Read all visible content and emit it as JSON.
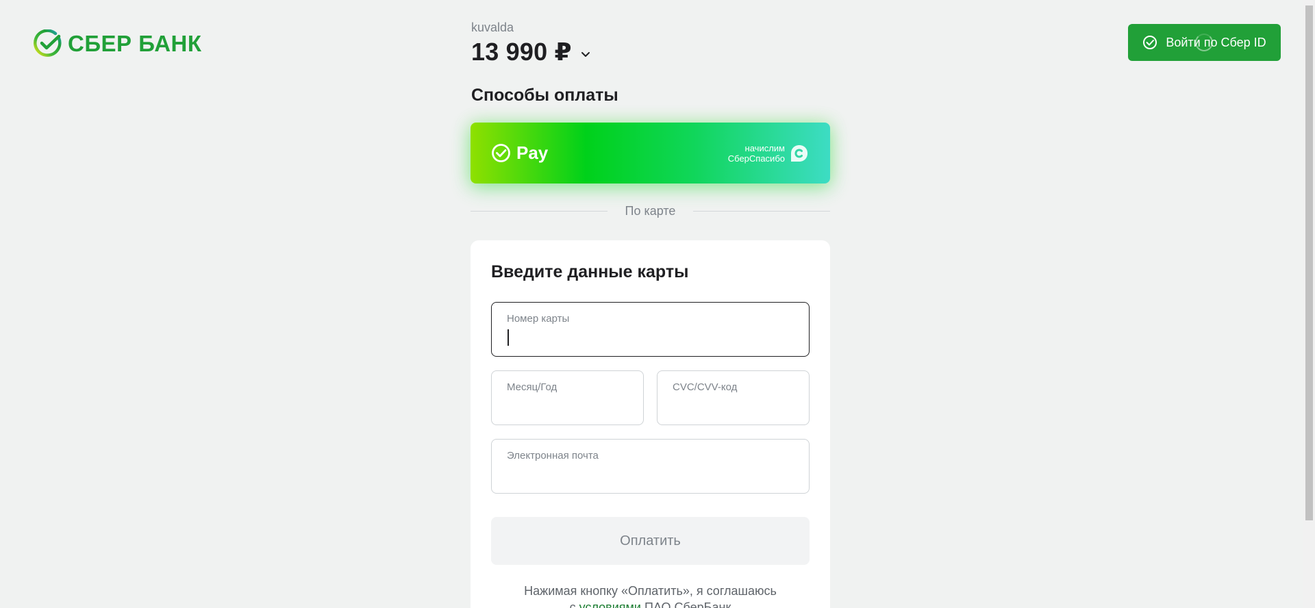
{
  "brand": {
    "logo_text": "СБЕР БАНК",
    "color": "#21a038"
  },
  "header": {
    "merchant": "kuvalda",
    "amount": "13 990 ₽",
    "sberid_button": "Войти по Сбер ID"
  },
  "payment_methods": {
    "title": "Способы оплаты",
    "sberpay_label": "Pay",
    "bonus_line1": "начислим",
    "bonus_line2": "СберСпасибо",
    "divider_text": "По карте"
  },
  "card_form": {
    "title": "Введите данные карты",
    "card_number_label": "Номер карты",
    "card_number_value": "",
    "expiry_label": "Месяц/Год",
    "expiry_value": "",
    "cvc_label": "CVC/CVV-код",
    "cvc_value": "",
    "email_label": "Электронная почта",
    "email_value": "",
    "submit_label": "Оплатить",
    "consent_text": "Нажимая кнопку «Оплатить», я соглашаюсь",
    "consent_prefix": "с",
    "consent_link": "условиями",
    "consent_suffix": "ПАО СберБанк"
  },
  "colors": {
    "accent": "#21a038",
    "background": "#f0f2f1",
    "muted_text": "#7d838a"
  },
  "icons": {
    "logo": "sber-logo-icon",
    "chevron": "chevron-down-icon",
    "sberid": "check-circle-icon",
    "spasibo": "spasibo-icon"
  }
}
